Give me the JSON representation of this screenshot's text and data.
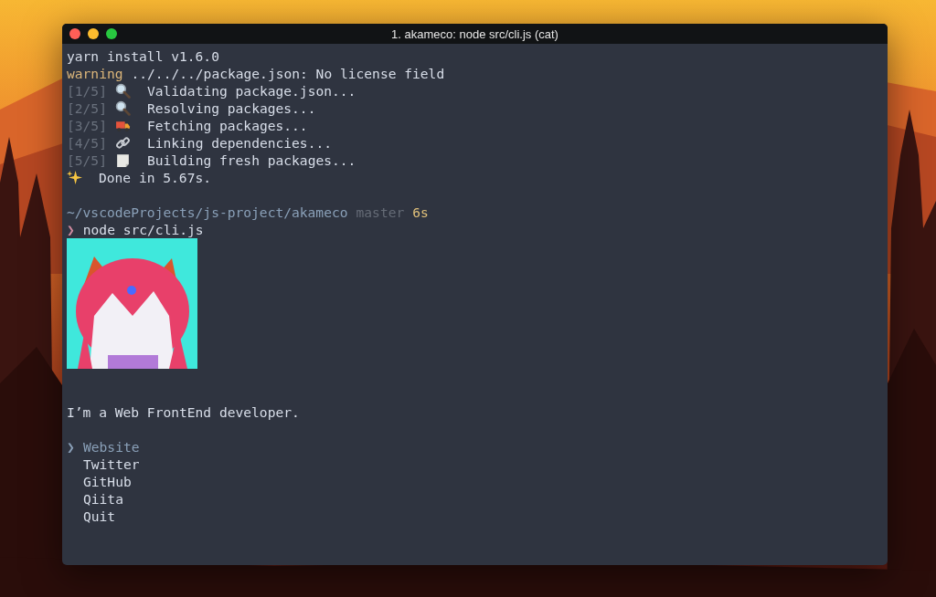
{
  "window": {
    "title": "1. akameco: node src/cli.js (cat)"
  },
  "terminal": {
    "command_header": "yarn install v1.6.0",
    "warning": {
      "label": "warning",
      "text": "../../../package.json: No license field"
    },
    "steps": [
      {
        "counter": "[1/5]",
        "kind": "search",
        "text": "Validating package.json..."
      },
      {
        "counter": "[2/5]",
        "kind": "search",
        "text": "Resolving packages..."
      },
      {
        "counter": "[3/5]",
        "kind": "truck",
        "text": "Fetching packages..."
      },
      {
        "counter": "[4/5]",
        "kind": "link",
        "text": "Linking dependencies..."
      },
      {
        "counter": "[5/5]",
        "kind": "page",
        "text": "Building fresh packages..."
      }
    ],
    "done": {
      "kind": "sparkle",
      "text": "Done in 5.67s."
    },
    "prompt": {
      "path": "~/vscodeProjects/js-project/akameco",
      "branch": "master",
      "duration": "6s",
      "symbol": "❯",
      "command": "node src/cli.js"
    },
    "message": "I’m a Web FrontEnd developer.",
    "menu": {
      "pointer": "❯",
      "items": [
        {
          "label": "Website",
          "selected": true
        },
        {
          "label": "Twitter",
          "selected": false
        },
        {
          "label": "GitHub",
          "selected": false
        },
        {
          "label": "Qiita",
          "selected": false
        },
        {
          "label": "Quit",
          "selected": false
        }
      ]
    }
  }
}
